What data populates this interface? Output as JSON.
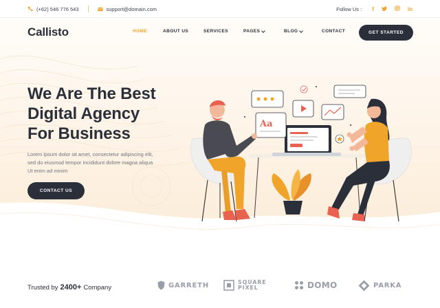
{
  "topbar": {
    "phone": "(+62) 546 776 543",
    "email": "support@domain.com",
    "follow_label": "Follow Us :",
    "socials": [
      {
        "icon": "facebook-icon",
        "glyph": "f"
      },
      {
        "icon": "twitter-icon",
        "glyph": "t"
      },
      {
        "icon": "instagram-icon",
        "glyph": "◎"
      },
      {
        "icon": "linkedin-icon",
        "glyph": "in"
      }
    ]
  },
  "header": {
    "logo": "Callisto",
    "nav": [
      {
        "label": "HOME",
        "active": true,
        "dropdown": false
      },
      {
        "label": "ABOUT US",
        "active": false,
        "dropdown": false
      },
      {
        "label": "SERVICES",
        "active": false,
        "dropdown": false
      },
      {
        "label": "PAGES",
        "active": false,
        "dropdown": true
      },
      {
        "label": "BLOG",
        "active": false,
        "dropdown": true
      },
      {
        "label": "CONTACT",
        "active": false,
        "dropdown": false
      }
    ],
    "cta": "GET STARTED"
  },
  "hero": {
    "title_line1": "We Are The Best",
    "title_line2": "Digital Agency",
    "title_line3": "For Business",
    "description": "Lorem ipsum dolor sit amet, consectetur adipiscing elit, sed do eiusmod tempor incididunt dolore magna aliqua Ut enim ad minim",
    "cta": "CONTACT US",
    "illustration_text": "Aa"
  },
  "trusted": {
    "prefix": "Trusted by",
    "count": "2400+",
    "suffix": "Company"
  },
  "brands": [
    {
      "name": "GARRETH",
      "icon": "shield-logo-icon"
    },
    {
      "name": "SQUARE PIXEL",
      "icon": "square-logo-icon"
    },
    {
      "name": "DOMO",
      "icon": "dots-logo-icon"
    },
    {
      "name": "PARKA",
      "icon": "diamond-logo-icon"
    }
  ],
  "colors": {
    "accent": "#f0a52a",
    "dark": "#2b2f3a",
    "hero_bg": "#fdf2e4"
  }
}
